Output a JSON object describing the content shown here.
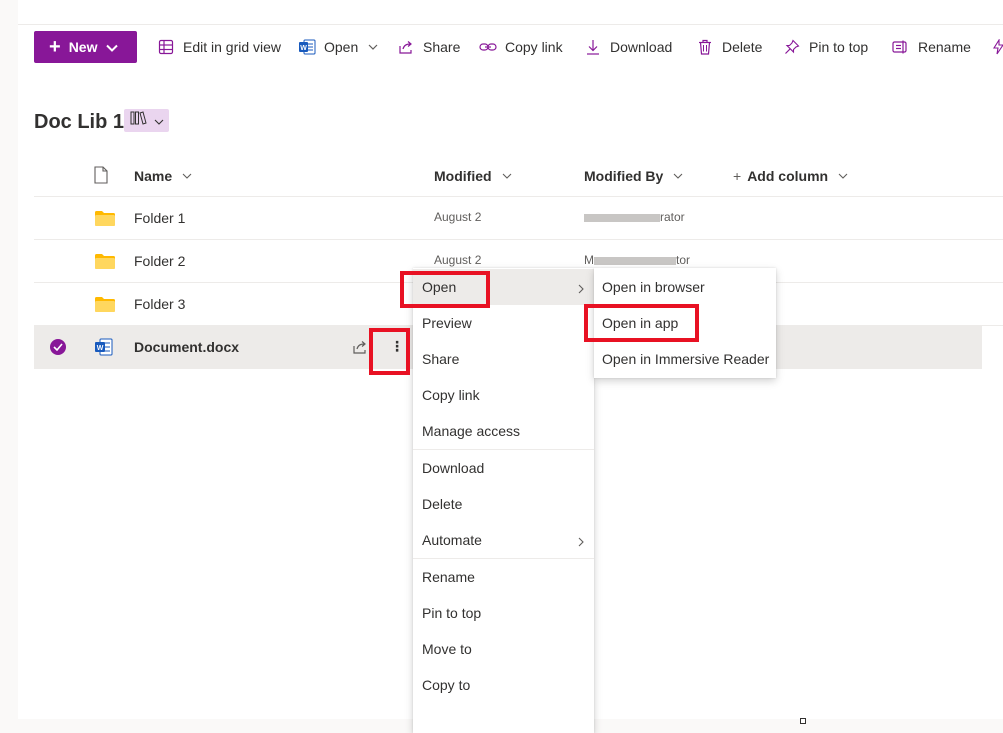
{
  "toolbar": {
    "new_label": "New",
    "edit_grid_label": "Edit in grid view",
    "open_label": "Open",
    "share_label": "Share",
    "copy_link_label": "Copy link",
    "download_label": "Download",
    "delete_label": "Delete",
    "pin_label": "Pin to top",
    "rename_label": "Rename"
  },
  "library": {
    "title": "Doc Lib 1"
  },
  "columns": {
    "name": "Name",
    "modified": "Modified",
    "modified_by": "Modified By",
    "add_column": "Add column"
  },
  "rows": [
    {
      "name": "Folder 1",
      "modified": "August 2",
      "modified_by_suffix": "rator"
    },
    {
      "name": "Folder 2",
      "modified": "August 2",
      "modified_by_prefix": "M",
      "modified_by_suffix": "tor"
    },
    {
      "name": "Folder 3"
    },
    {
      "name": "Document.docx"
    }
  ],
  "context_menu": {
    "items": [
      "Open",
      "Preview",
      "Share",
      "Copy link",
      "Manage access",
      "Download",
      "Delete",
      "Automate",
      "Rename",
      "Pin to top",
      "Move to",
      "Copy to"
    ]
  },
  "open_submenu": {
    "items": [
      "Open in browser",
      "Open in app",
      "Open in Immersive Reader"
    ]
  },
  "colors": {
    "accent": "#881798",
    "highlight": "#e81123",
    "folder": "#ffb900",
    "word": "#185abd"
  }
}
